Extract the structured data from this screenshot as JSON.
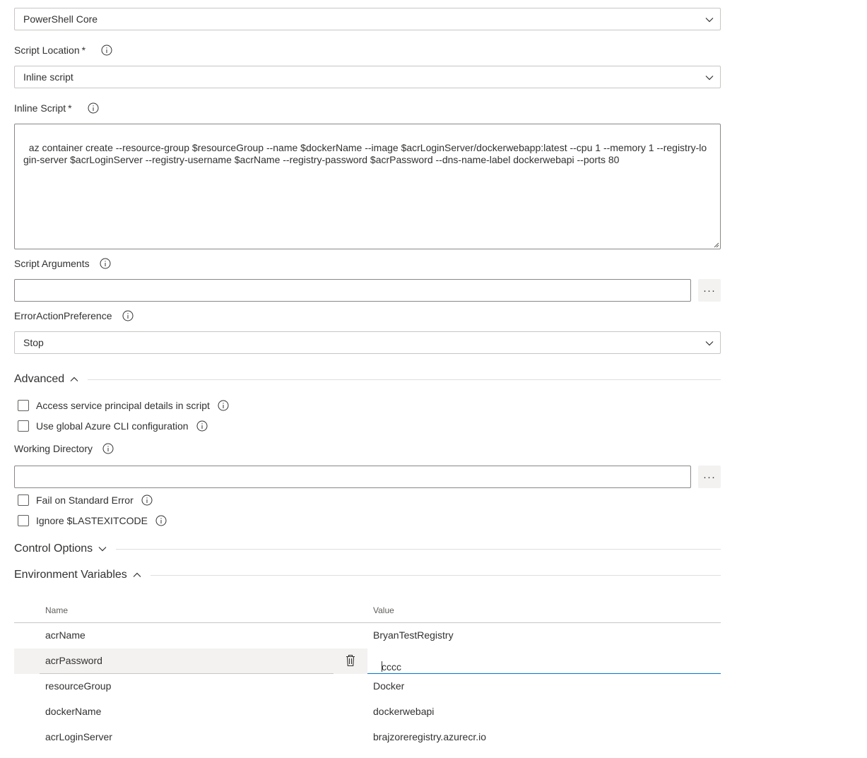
{
  "script_type": {
    "selected": "PowerShell Core"
  },
  "script_location": {
    "label": "Script Location",
    "required": "*",
    "selected": "Inline script"
  },
  "inline_script": {
    "label": "Inline Script",
    "required": "*",
    "value": "az container create --resource-group $resourceGroup --name $dockerName --image $acrLoginServer/dockerwebapp:latest --cpu 1 --memory 1 --registry-login-server $acrLoginServer --registry-username $acrName --registry-password $acrPassword --dns-name-label dockerwebapi --ports 80"
  },
  "script_arguments": {
    "label": "Script Arguments",
    "value": "",
    "ellipsis": "···"
  },
  "error_action_preference": {
    "label": "ErrorActionPreference",
    "selected": "Stop"
  },
  "advanced": {
    "title": "Advanced",
    "access_principal": "Access service principal details in script",
    "global_cli": "Use global Azure CLI configuration",
    "working_directory": {
      "label": "Working Directory",
      "value": "",
      "ellipsis": "···"
    },
    "fail_on_stderr": "Fail on Standard Error",
    "ignore_lastexitcode": "Ignore $LASTEXITCODE"
  },
  "control_options": {
    "title": "Control Options"
  },
  "environment_variables": {
    "title": "Environment Variables",
    "columns": {
      "name": "Name",
      "value": "Value"
    },
    "rows": [
      {
        "name": "acrName",
        "value": "BryanTestRegistry"
      },
      {
        "name": "acrPassword",
        "value": "cccc"
      },
      {
        "name": "resourceGroup",
        "value": "Docker"
      },
      {
        "name": "dockerName",
        "value": "dockerwebapi"
      },
      {
        "name": "acrLoginServer",
        "value": "brajzoreregistry.azurecr.io"
      }
    ]
  },
  "colors": {
    "accent": "#0078d4",
    "border": "#8a8886",
    "text": "#323130",
    "hover_bg": "#f3f2f1"
  }
}
